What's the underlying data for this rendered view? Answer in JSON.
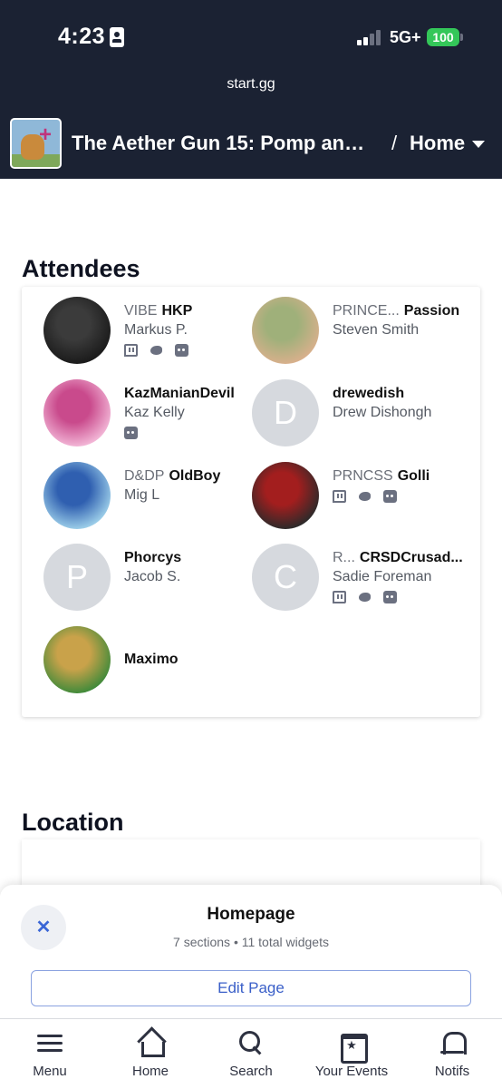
{
  "status_bar": {
    "time": "4:23",
    "network": "5G+",
    "battery": "100",
    "battery_color": "#34c759"
  },
  "browser": {
    "url": "start.gg"
  },
  "header": {
    "event_title": "The Aether Gun 15: Pomp and ...",
    "separator": "/",
    "current_page": "Home",
    "background_color": "#1b2233"
  },
  "attendees": {
    "title": "Attendees",
    "list": [
      {
        "prefix": "VIBE",
        "gamertag": "HKP",
        "real_name": "Markus P.",
        "avatar": {
          "type": "photo",
          "colors": [
            "#1a1a1a",
            "#3b3b3b"
          ]
        },
        "socials": [
          "twitch-icon",
          "twitter-icon",
          "discord-icon"
        ]
      },
      {
        "prefix": "PRINCE...",
        "gamertag": "Passion",
        "real_name": "Steven Smith",
        "avatar": {
          "type": "photo",
          "colors": [
            "#d9b08c",
            "#9fb07a"
          ]
        },
        "socials": []
      },
      {
        "prefix": "",
        "gamertag": "KazManianDevil",
        "real_name": "Kaz Kelly",
        "avatar": {
          "type": "photo",
          "colors": [
            "#f3b8d8",
            "#c94a8c"
          ]
        },
        "socials": [
          "discord-icon"
        ]
      },
      {
        "prefix": "",
        "gamertag": "drewedish",
        "real_name": "Drew Dishongh",
        "avatar": {
          "type": "letter",
          "letter": "D"
        },
        "socials": []
      },
      {
        "prefix": "D&DP",
        "gamertag": "OldBoy",
        "real_name": "Mig L",
        "avatar": {
          "type": "photo",
          "colors": [
            "#9ed0ea",
            "#2f5fb0"
          ]
        },
        "socials": []
      },
      {
        "prefix": "PRNCSS",
        "gamertag": "Golli",
        "real_name": "",
        "avatar": {
          "type": "photo",
          "colors": [
            "#2a2a2a",
            "#a31e1e"
          ]
        },
        "socials": [
          "twitch-icon",
          "twitter-icon",
          "discord-icon"
        ]
      },
      {
        "prefix": "",
        "gamertag": "Phorcys",
        "real_name": "Jacob S.",
        "avatar": {
          "type": "letter",
          "letter": "P"
        },
        "socials": []
      },
      {
        "prefix": "R...",
        "gamertag": "CRSDCrusad...",
        "real_name": "Sadie Foreman",
        "avatar": {
          "type": "letter",
          "letter": "C"
        },
        "socials": [
          "twitch-icon",
          "twitter-icon",
          "discord-icon"
        ]
      },
      {
        "prefix": "",
        "gamertag": "Maximo",
        "real_name": "",
        "avatar": {
          "type": "photo",
          "colors": [
            "#3e8a3a",
            "#c9a24a"
          ]
        },
        "socials": []
      }
    ]
  },
  "location": {
    "title": "Location"
  },
  "sheet": {
    "title": "Homepage",
    "subtitle": "7 sections • 11 total widgets",
    "close_symbol": "✕",
    "edit_label": "Edit Page"
  },
  "tabbar": {
    "tabs": [
      {
        "label": "Menu",
        "icon": "menu-icon"
      },
      {
        "label": "Home",
        "icon": "home-icon"
      },
      {
        "label": "Search",
        "icon": "search-icon"
      },
      {
        "label": "Your Events",
        "icon": "calendar-icon"
      },
      {
        "label": "Notifs",
        "icon": "bell-icon"
      }
    ]
  }
}
